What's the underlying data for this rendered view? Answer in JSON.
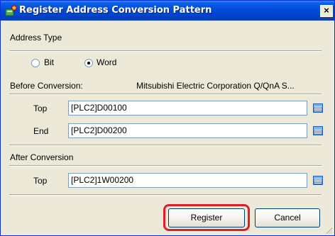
{
  "window": {
    "title": "Register Address Conversion Pattern",
    "close_glyph": "×"
  },
  "address_type": {
    "label": "Address Type",
    "options": [
      {
        "label": "Bit",
        "checked": false
      },
      {
        "label": "Word",
        "checked": true
      }
    ]
  },
  "before_conversion": {
    "label": "Before Conversion:",
    "device": "Mitsubishi  Electric  Corporation  Q/QnA  S...",
    "top_label": "Top",
    "top_value": "[PLC2]D00100",
    "end_label": "End",
    "end_value": "[PLC2]D00200"
  },
  "after_conversion": {
    "label": "After Conversion",
    "top_label": "Top",
    "top_value": "[PLC2]1W00200"
  },
  "buttons": {
    "register": "Register",
    "cancel": "Cancel"
  },
  "icons": {
    "title": "address-pattern-icon",
    "browse": "address-browse-icon"
  },
  "colors": {
    "titlebar": "#0048d8",
    "highlight": "#e21d2a",
    "dialog_bg": "#ece9d8"
  }
}
